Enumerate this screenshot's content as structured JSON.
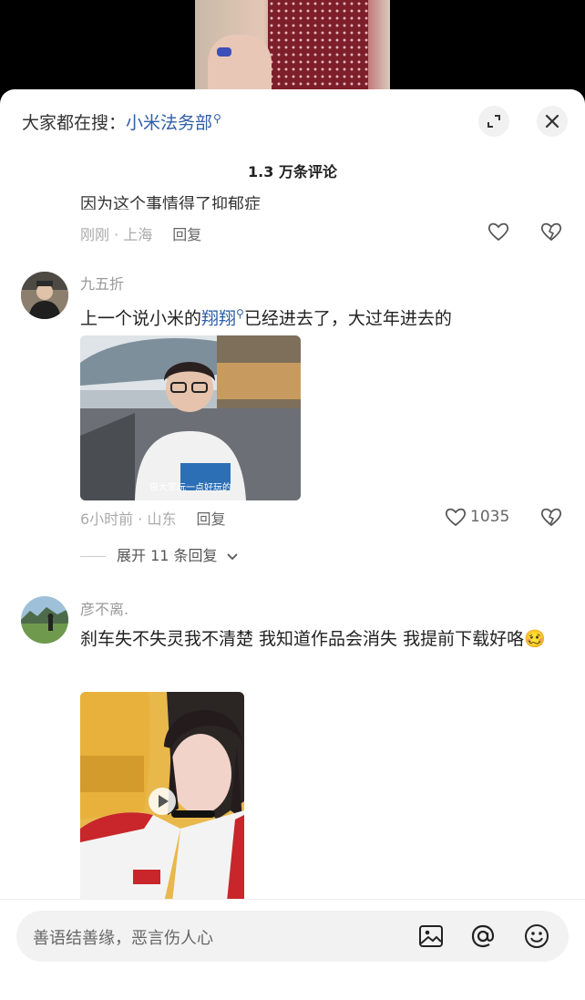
{
  "search": {
    "prefix": "大家都在搜：",
    "keyword": "小米法务部",
    "keyword_icon": "search-hint-icon"
  },
  "header": {
    "comment_count": "1.3 万条评论",
    "expand_icon": "expand-icon",
    "close_icon": "close-icon"
  },
  "comments": [
    {
      "text": "因为这个事情得了抑郁症",
      "time_location": "刚刚 · 上海",
      "reply_label": "回复"
    },
    {
      "username": "九五折",
      "text_before": "上一个说小米的",
      "keyword": "翔翔",
      "text_after": "已经进去了，大过年进去的",
      "image_caption": "带大家玩一点好玩的",
      "time_location": "6小时前 · 山东",
      "reply_label": "回复",
      "likes": "1035",
      "expand_replies": "展开 11 条回复"
    },
    {
      "username": "彦不离.",
      "text": "刹车失不失灵我不清楚 我知道作品会消失 我提前下载好咯",
      "emoji": "🥴"
    }
  ],
  "composer": {
    "placeholder": "善语结善缘，恶言伤人心",
    "icons": [
      "image-icon",
      "at-icon",
      "emoji-icon"
    ]
  },
  "colors": {
    "link": "#2f5ea8",
    "muted": "#aaaaaa",
    "text": "#222222"
  }
}
